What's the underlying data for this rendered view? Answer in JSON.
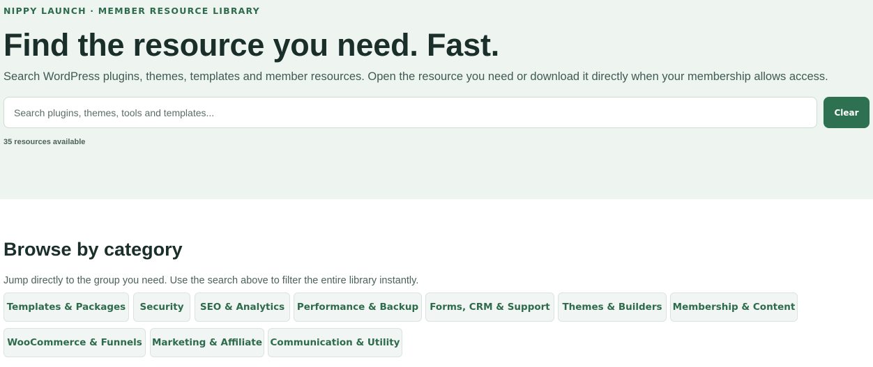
{
  "hero": {
    "eyebrow": "NIPPY LAUNCH · MEMBER RESOURCE LIBRARY",
    "title": "Find the resource you need. Fast.",
    "subtitle": "Search WordPress plugins, themes, templates and member resources. Open the resource you need or download it directly when your membership allows access."
  },
  "search": {
    "placeholder": "Search plugins, themes, tools and templates...",
    "value": "",
    "clear_label": "Clear",
    "count_text": "35 resources available"
  },
  "browse": {
    "title": "Browse by category",
    "subtitle": "Jump directly to the group you need. Use the search above to filter the entire library instantly.",
    "categories": [
      "Templates & Packages",
      "Security",
      "SEO & Analytics",
      "Performance & Backup",
      "Forms, CRM & Support",
      "Themes & Builders",
      "Membership & Content",
      "WooCommerce & Funnels",
      "Marketing & Affiliate",
      "Communication & Utility"
    ]
  },
  "colors": {
    "hero_bg": "#eef5f0",
    "accent": "#2e7150",
    "heading": "#1b2f2a"
  }
}
